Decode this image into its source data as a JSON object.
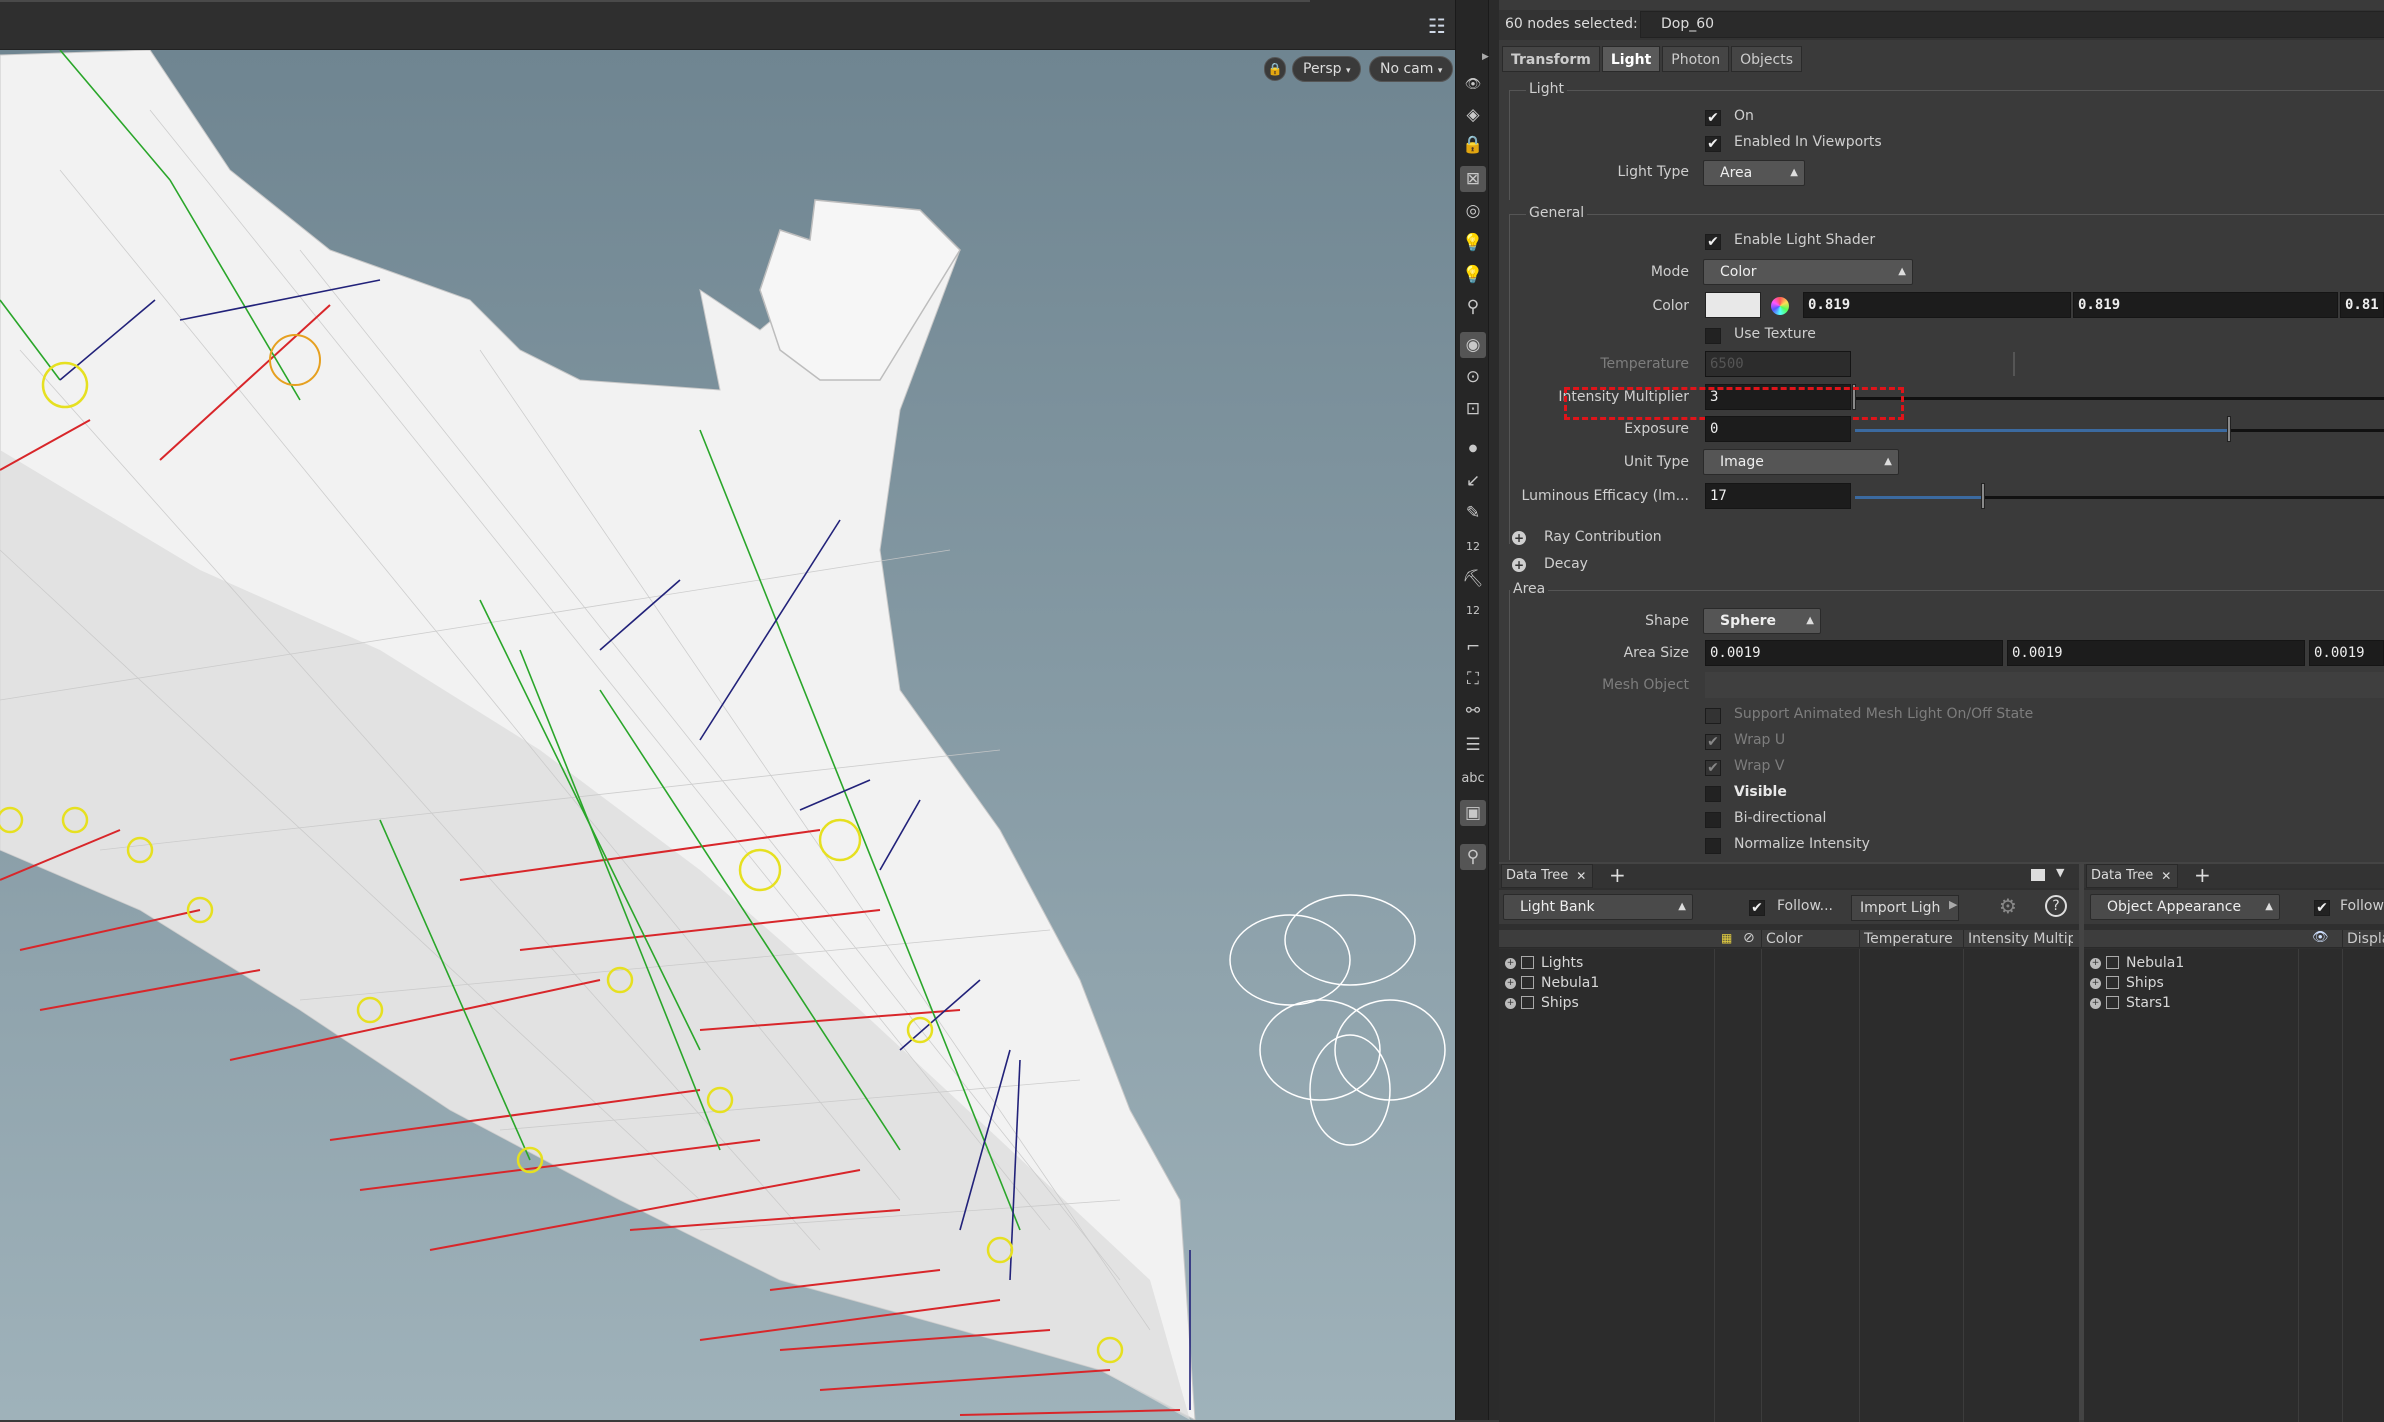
{
  "viewport": {
    "persp_label": "Persp",
    "cam_label": "No cam",
    "overlay_numbers": [
      "12",
      "12"
    ],
    "overlay_text": "abc"
  },
  "params": {
    "selection_text": "60 nodes selected:",
    "node_name": "Dop_60",
    "tabs": [
      "Transform",
      "Light",
      "Photon",
      "Objects"
    ],
    "active_tab": "Light",
    "light_section": {
      "title": "Light",
      "on_label": "On",
      "enabled_viewports_label": "Enabled In Viewports",
      "light_type_label": "Light Type",
      "light_type_value": "Area"
    },
    "general_section": {
      "title": "General",
      "enable_shader_label": "Enable Light Shader",
      "mode_label": "Mode",
      "mode_value": "Color",
      "color_label": "Color",
      "color_r": "0.819",
      "color_g": "0.819",
      "color_b": "0.81",
      "use_texture_label": "Use Texture",
      "temperature_label": "Temperature",
      "temperature_value": "6500",
      "intensity_label": "Intensity Multiplier",
      "intensity_value": "3",
      "intensity_fraction": 0.5,
      "exposure_label": "Exposure",
      "exposure_value": "0",
      "unit_type_label": "Unit Type",
      "unit_type_value": "Image",
      "luminous_label": "Luminous Efficacy (lm...",
      "luminous_value": "17"
    },
    "ray_contribution_label": "Ray Contribution",
    "decay_label": "Decay",
    "area_section": {
      "title": "Area",
      "shape_label": "Shape",
      "shape_value": "Sphere",
      "area_size_label": "Area Size",
      "area_size_x": "0.0019",
      "area_size_y": "0.0019",
      "area_size_z": "0.0019",
      "mesh_object_label": "Mesh Object",
      "support_animated_label": "Support Animated Mesh Light On/Off State",
      "wrap_u_label": "Wrap U",
      "wrap_v_label": "Wrap V",
      "visible_label": "Visible",
      "bidirectional_label": "Bi-directional",
      "normalize_label": "Normalize Intensity"
    }
  },
  "data_tree_left": {
    "tab_label": "Data Tree",
    "view_mode": "Light Bank",
    "follow_label": "Follow...",
    "import_label": "Import Ligh",
    "columns": [
      "Color",
      "Temperature",
      "Intensity Multip"
    ],
    "rows": [
      "Lights",
      "Nebula1",
      "Ships"
    ]
  },
  "data_tree_right": {
    "tab_label": "Data Tree",
    "view_mode": "Object Appearance",
    "follow_label": "Follow",
    "columns": [
      "Displa"
    ],
    "rows": [
      "Nebula1",
      "Ships",
      "Stars1"
    ]
  },
  "colors": {
    "highlight_box": "#e0141a",
    "exposure_slider": "#3b6aa0",
    "light_red": "#d8262a",
    "light_blue": "#22227a",
    "light_green": "#2aa62a",
    "area_yellow": "#e6e020"
  }
}
